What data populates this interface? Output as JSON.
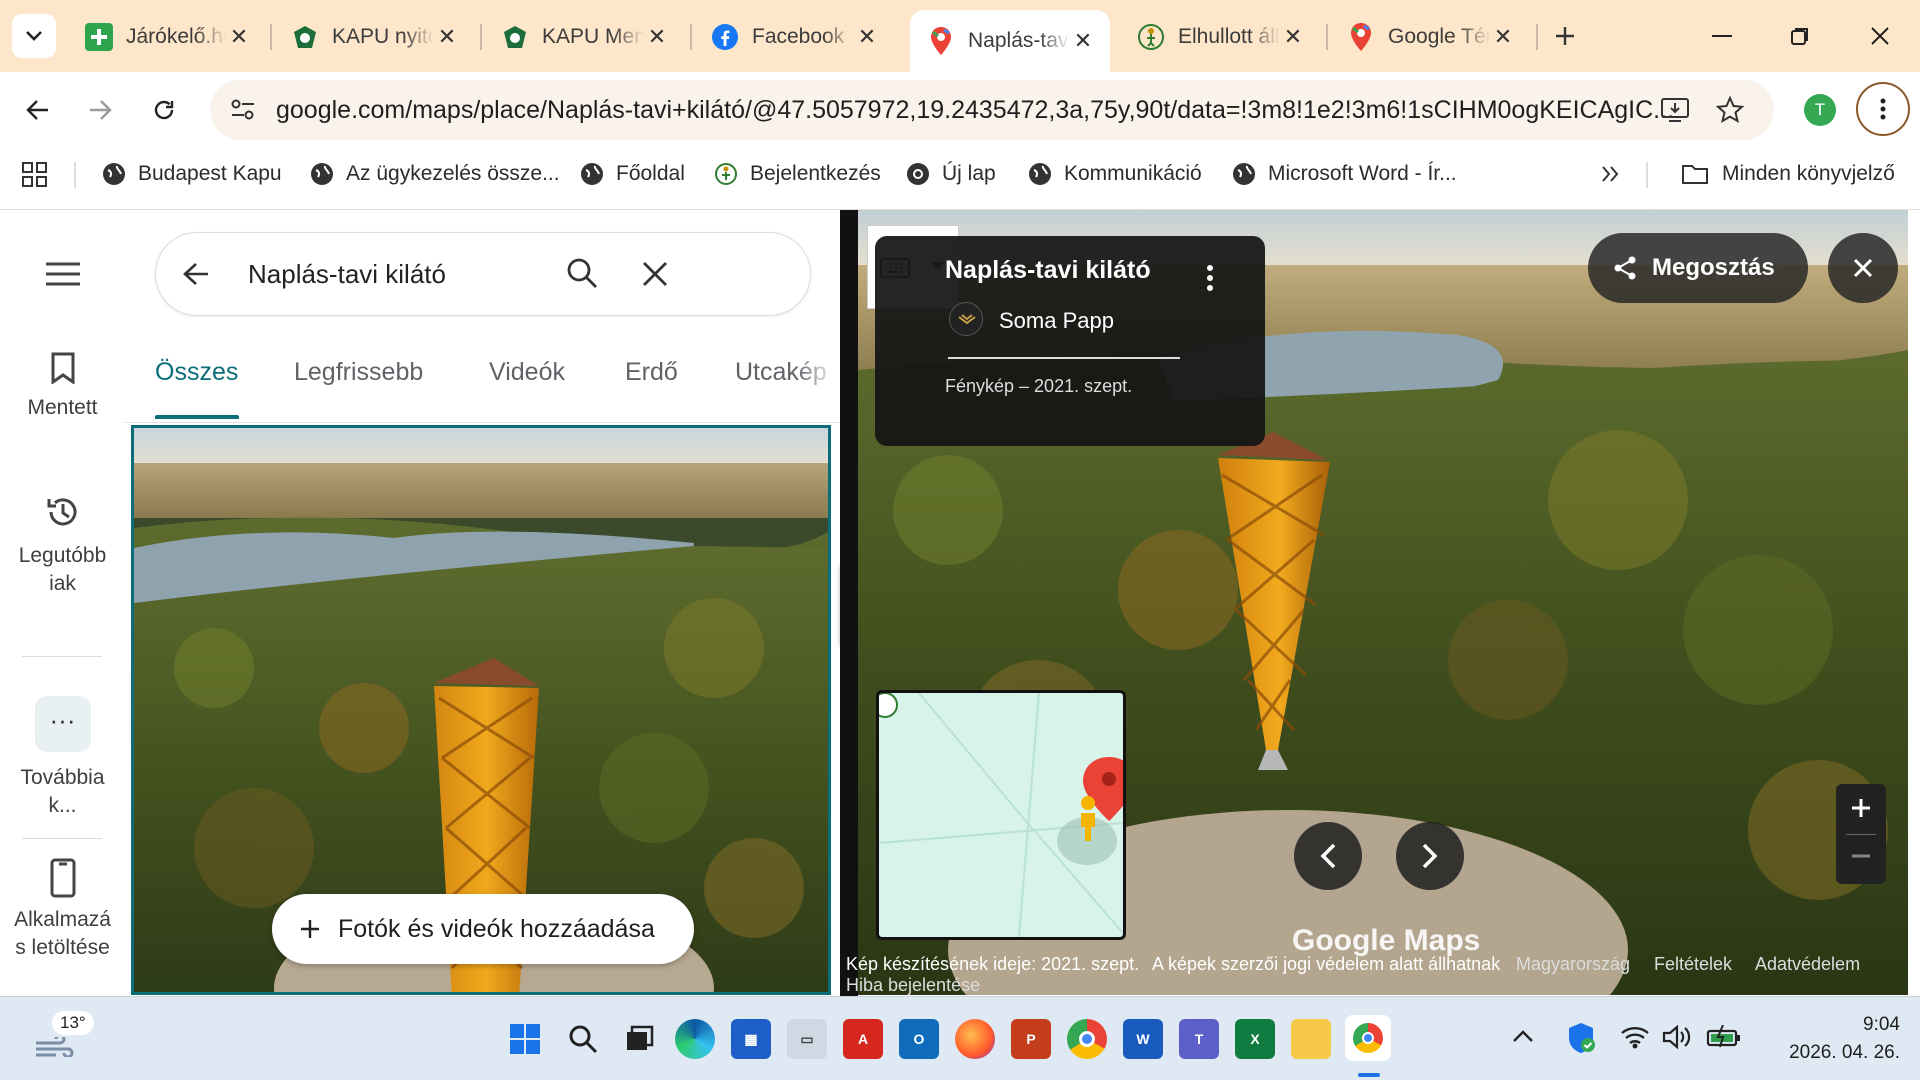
{
  "tabs": [
    {
      "label": "Járókelő.hu",
      "close": "✕",
      "icon": "jarokelo-icon"
    },
    {
      "label": "KAPU nyitó",
      "close": "✕",
      "icon": "kapu-icon"
    },
    {
      "label": "KAPU Menü",
      "close": "✕",
      "icon": "kapu-icon"
    },
    {
      "label": "Facebook",
      "close": "✕",
      "icon": "facebook-icon"
    },
    {
      "label": "Naplás-tavi kilátó",
      "close": "✕",
      "icon": "maps-pin-icon"
    },
    {
      "label": "Elhullott állat",
      "close": "✕",
      "icon": "ugyfelkapu-icon"
    },
    {
      "label": "Google Térkép",
      "close": "✕",
      "icon": "maps-pin-icon"
    }
  ],
  "toolbar": {
    "url": "google.com/maps/place/Naplás-tavi+kilátó/@47.5057972,19.2435472,3a,75y,90t/data=!3m8!1e2!3m6!1sCIHM0ogKEICAgIC...",
    "profile_initial": "T"
  },
  "bookmarks": [
    {
      "label": "Budapest Kapu"
    },
    {
      "label": "Az ügykezelés össze..."
    },
    {
      "label": "Főoldal"
    },
    {
      "label": "Bejelentkezés"
    },
    {
      "label": "Új lap"
    },
    {
      "label": "Kommunikáció"
    },
    {
      "label": "Microsoft Word - Ír..."
    },
    {
      "label": "Minden könyvjelző"
    }
  ],
  "rail": {
    "saved": "Mentett",
    "recent_1": "Legutóbb",
    "recent_2": "iak",
    "more_1": "Továbbia",
    "more_2": "k...",
    "app_1": "Alkalmazá",
    "app_2": "s letöltése"
  },
  "search": {
    "query": "Naplás-tavi kilátó"
  },
  "photo_tabs": [
    "Összes",
    "Legfrissebb",
    "Videók",
    "Erdő",
    "Utcakép"
  ],
  "add_media": "Fotók és videók hozzáadása",
  "info_card": {
    "place": "Naplás-tavi kilátó",
    "author": "Soma Papp",
    "meta": "Fénykép – 2021. szept."
  },
  "share": "Megosztás",
  "watermark": "Google Maps",
  "footer": {
    "date": "Kép készítésének ideje: 2021. szept.",
    "copyright": "A képek szerzői jogi védelem alatt állhatnak",
    "country": "Magyarország",
    "terms": "Feltételek",
    "privacy": "Adatvédelem",
    "report": "Hiba bejelentése"
  },
  "taskbar": {
    "temperature": "13°",
    "time": "9:04",
    "date": "2026. 04. 26."
  },
  "colors": {
    "tabstrip": "#fde6c9",
    "active_tab_accent": "#0b6e79",
    "maps_red": "#ea4335"
  }
}
